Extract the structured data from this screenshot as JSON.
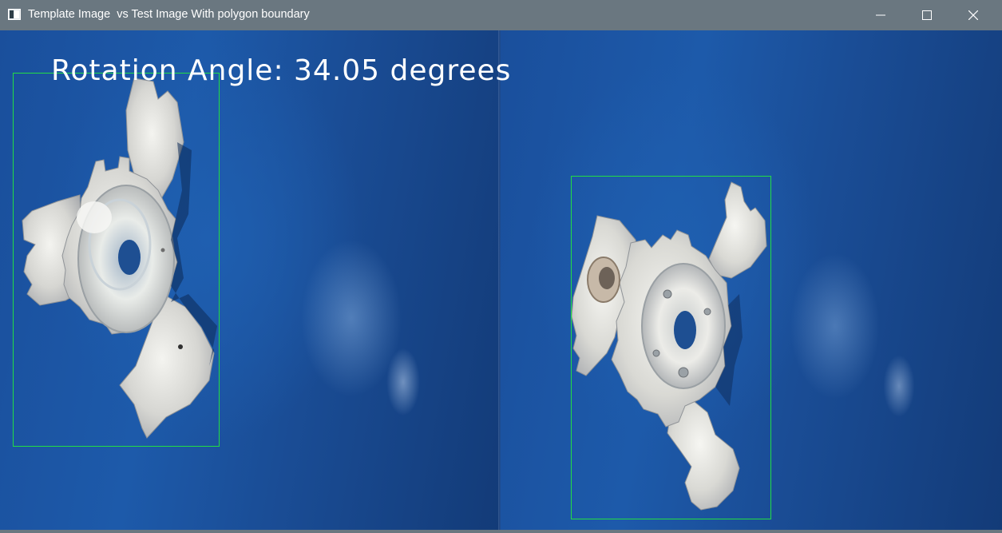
{
  "window": {
    "title": "Template Image  vs Test Image With polygon boundary",
    "app_icon": "opencv-window-icon",
    "controls": {
      "minimize_icon": "minimize-icon",
      "maximize_icon": "maximize-icon",
      "close_icon": "close-icon"
    }
  },
  "overlay": {
    "rotation_text": "Rotation Angle: 34.05 degrees"
  },
  "colors": {
    "titlebar": "#6a7780",
    "background_blue": "#1a4f9c",
    "bbox_green": "#22dd44",
    "text_white": "#ffffff",
    "part_metal": "#d8d8d4"
  },
  "panels": {
    "template": {
      "label": "template-image",
      "boundary": "polygon-boundary"
    },
    "test": {
      "label": "test-image",
      "boundary": "polygon-boundary"
    }
  }
}
